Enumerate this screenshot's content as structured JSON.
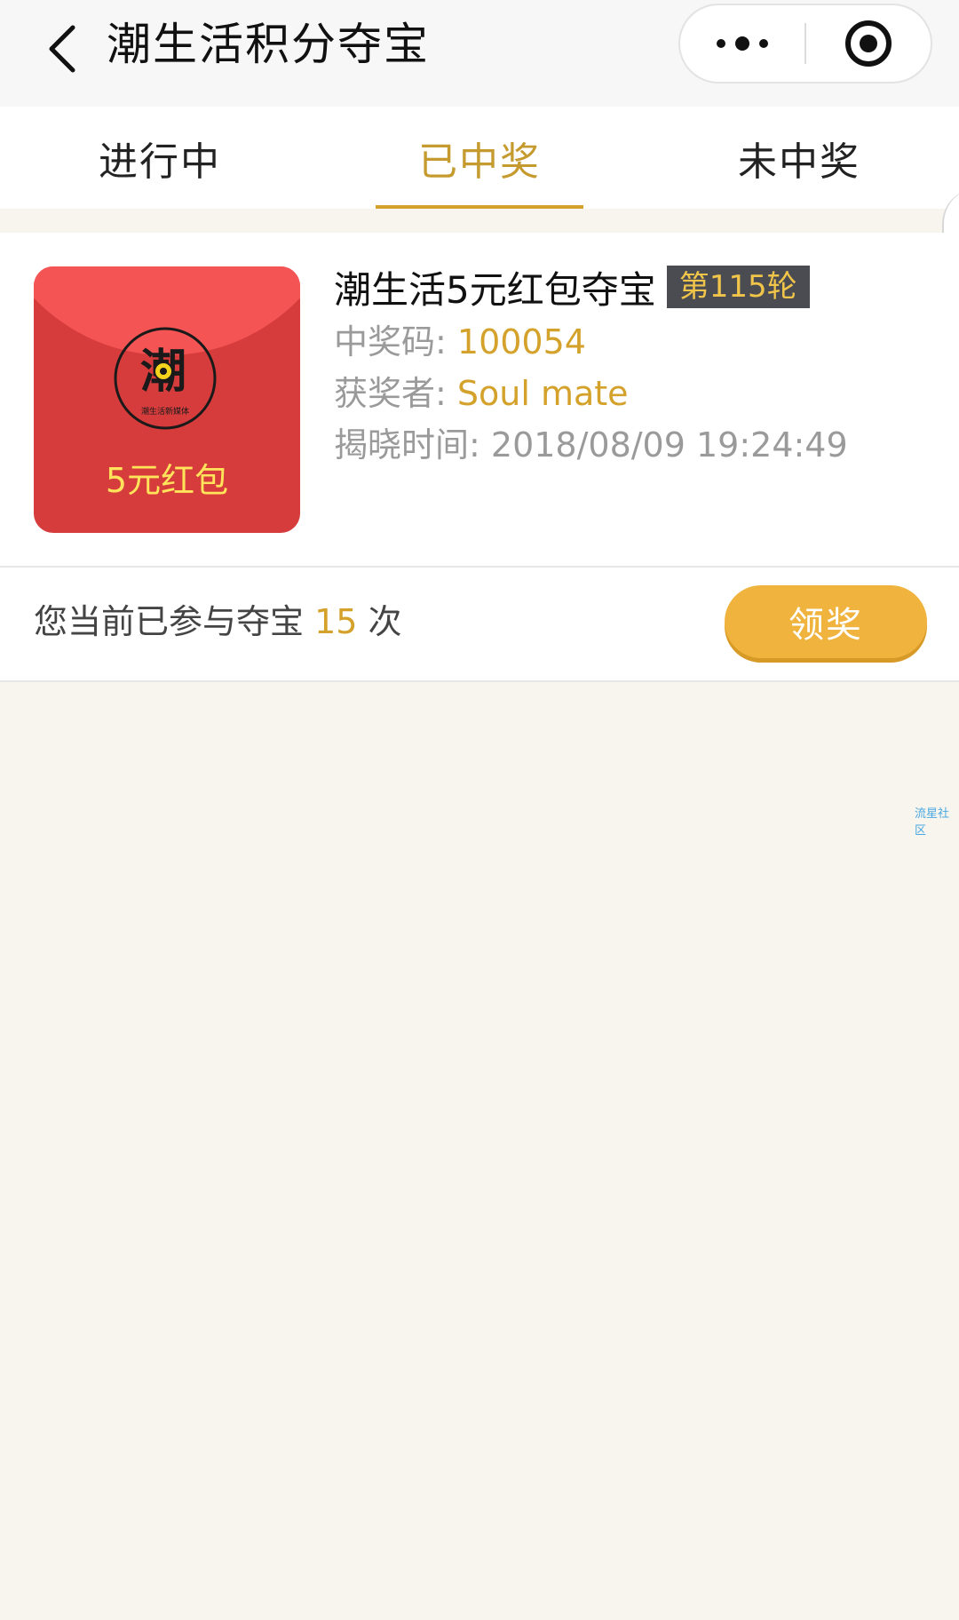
{
  "navbar": {
    "title": "潮生活积分夺宝",
    "back_icon": "chevron-left-icon",
    "more_icon": "more-dots-icon",
    "close_icon": "target-circle-icon"
  },
  "tabs": [
    {
      "label": "进行中",
      "active": false
    },
    {
      "label": "已中奖",
      "active": true
    },
    {
      "label": "未中奖",
      "active": false
    }
  ],
  "prize": {
    "thumbnail_label": "5元红包",
    "logo_char": "潮",
    "logo_caption": "潮生活新媒体",
    "title": "潮生活5元红包夺宝",
    "round": "第115轮",
    "code_label": "中奖码: ",
    "code_value": "100054",
    "winner_label": "获奖者: ",
    "winner_value": "Soul mate",
    "time_label": "揭晓时间: ",
    "time_value": "2018/08/09 19:24:49"
  },
  "participation": {
    "prefix": "您当前已参与夺宝 ",
    "count": "15",
    "suffix": " 次",
    "claim_label": "领奖"
  },
  "watermark": "流星社区",
  "colors": {
    "accent": "#d4a22b",
    "button": "#f0b33e",
    "badge_bg": "#4a4c52",
    "badge_text": "#f1c44a",
    "red_envelope": "#d63c3c",
    "background": "#f8f5ef"
  }
}
